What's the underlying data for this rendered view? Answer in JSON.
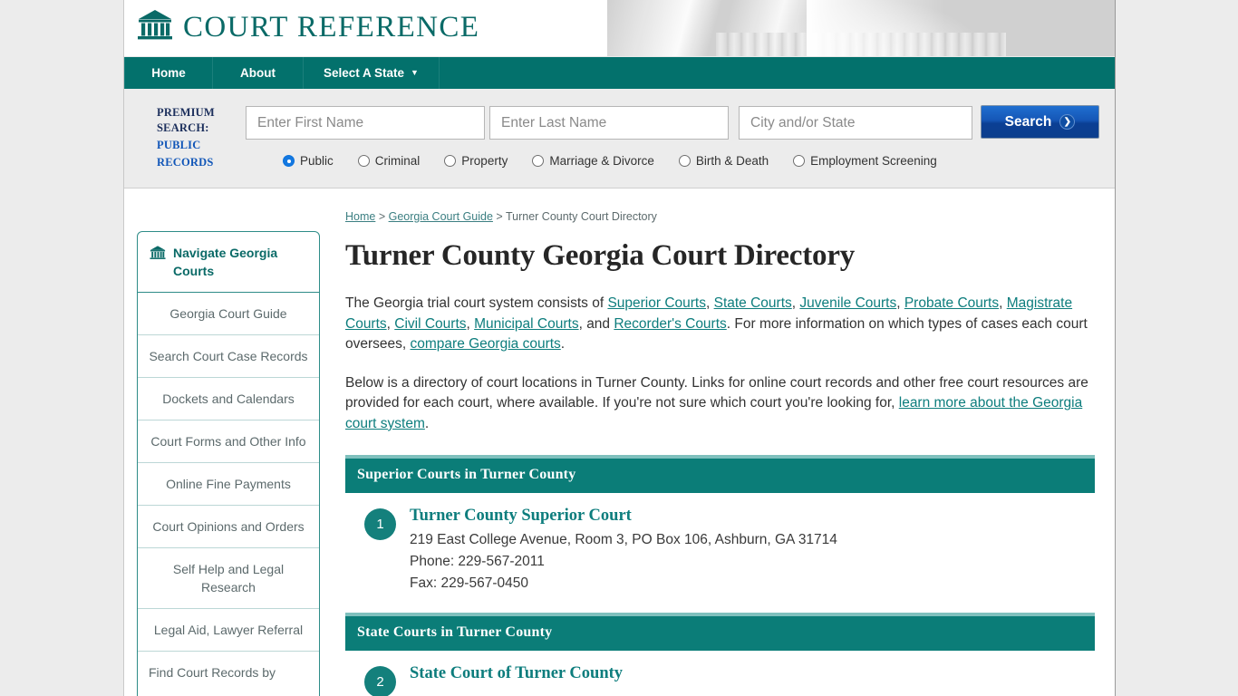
{
  "brand": {
    "name": "COURT REFERENCE",
    "logo_icon": "courthouse-icon"
  },
  "nav": {
    "items": [
      {
        "label": "Home"
      },
      {
        "label": "About"
      },
      {
        "label": "Select A State",
        "caret": "▼"
      }
    ]
  },
  "premium_search": {
    "label_line1": "PREMIUM",
    "label_line2": "SEARCH:",
    "label_line3": "PUBLIC",
    "label_line4": "RECORDS",
    "first_name_placeholder": "Enter First Name",
    "first_name_value": "",
    "last_name_placeholder": "Enter Last Name",
    "last_name_value": "",
    "city_state_placeholder": "City and/or State",
    "city_state_value": "",
    "search_button": "Search",
    "search_button_icon": "chevron-right-icon",
    "radios": [
      {
        "label": "Public",
        "selected": true
      },
      {
        "label": "Criminal",
        "selected": false
      },
      {
        "label": "Property",
        "selected": false
      },
      {
        "label": "Marriage & Divorce",
        "selected": false
      },
      {
        "label": "Birth & Death",
        "selected": false
      },
      {
        "label": "Employment Screening",
        "selected": false
      }
    ],
    "accent_button_color": "#1158b6",
    "accent_label_color": "#1156b8"
  },
  "sidebar": {
    "header_icon": "courthouse-icon",
    "header_label": "Navigate Georgia Courts",
    "items": [
      {
        "label": "Georgia Court Guide"
      },
      {
        "label": "Search Court Case Records"
      },
      {
        "label": "Dockets and Calendars"
      },
      {
        "label": "Court Forms and Other Info"
      },
      {
        "label": "Online Fine Payments"
      },
      {
        "label": "Court Opinions and Orders"
      },
      {
        "label": "Self Help and Legal Research"
      },
      {
        "label": "Legal Aid, Lawyer Referral"
      },
      {
        "label": "Find Court Records by"
      }
    ]
  },
  "breadcrumb": {
    "home": "Home",
    "sep1": " > ",
    "guide": "Georgia Court Guide",
    "sep2": " > ",
    "current": "Turner County Court Directory"
  },
  "main": {
    "title": "Turner County Georgia Court Directory",
    "p1": {
      "t1": "The Georgia trial court system consists of ",
      "l1": "Superior Courts",
      "t2": ", ",
      "l2": "State Courts",
      "t3": ", ",
      "l3": "Juvenile Courts",
      "t4": ", ",
      "l4": "Probate Courts",
      "t5": ", ",
      "l5": "Magistrate Courts",
      "t6": ", ",
      "l6": "Civil Courts",
      "t7": ", ",
      "l7": "Municipal Courts",
      "t8": ", and ",
      "l8": "Recorder's Courts",
      "t9": ". For more information on which types of cases each court oversees, ",
      "l9": "compare Georgia courts",
      "t10": "."
    },
    "p2": {
      "t1": "Below is a directory of court locations in Turner County. Links for online court records and other free court resources are provided for each court, where available. If you're not sure which court you're looking for, ",
      "l1": "learn more about the Georgia court system",
      "t2": "."
    },
    "sections": [
      {
        "heading": "Superior Courts in Turner County",
        "courts": [
          {
            "number": "1",
            "name": "Turner County Superior Court",
            "address": "219 East College Avenue, Room 3, PO Box 106, Ashburn, GA 31714",
            "phone": "Phone: 229-567-2011",
            "fax": "Fax: 229-567-0450"
          }
        ]
      },
      {
        "heading": "State Courts in Turner County",
        "courts": [
          {
            "number": "2",
            "name": "State Court of Turner County",
            "address": "",
            "phone": "",
            "fax": ""
          }
        ]
      }
    ]
  },
  "colors": {
    "teal": "#0b7d78",
    "teal_dark": "#03716c",
    "link": "#0d7d7d",
    "page_bg": "#ececec"
  }
}
